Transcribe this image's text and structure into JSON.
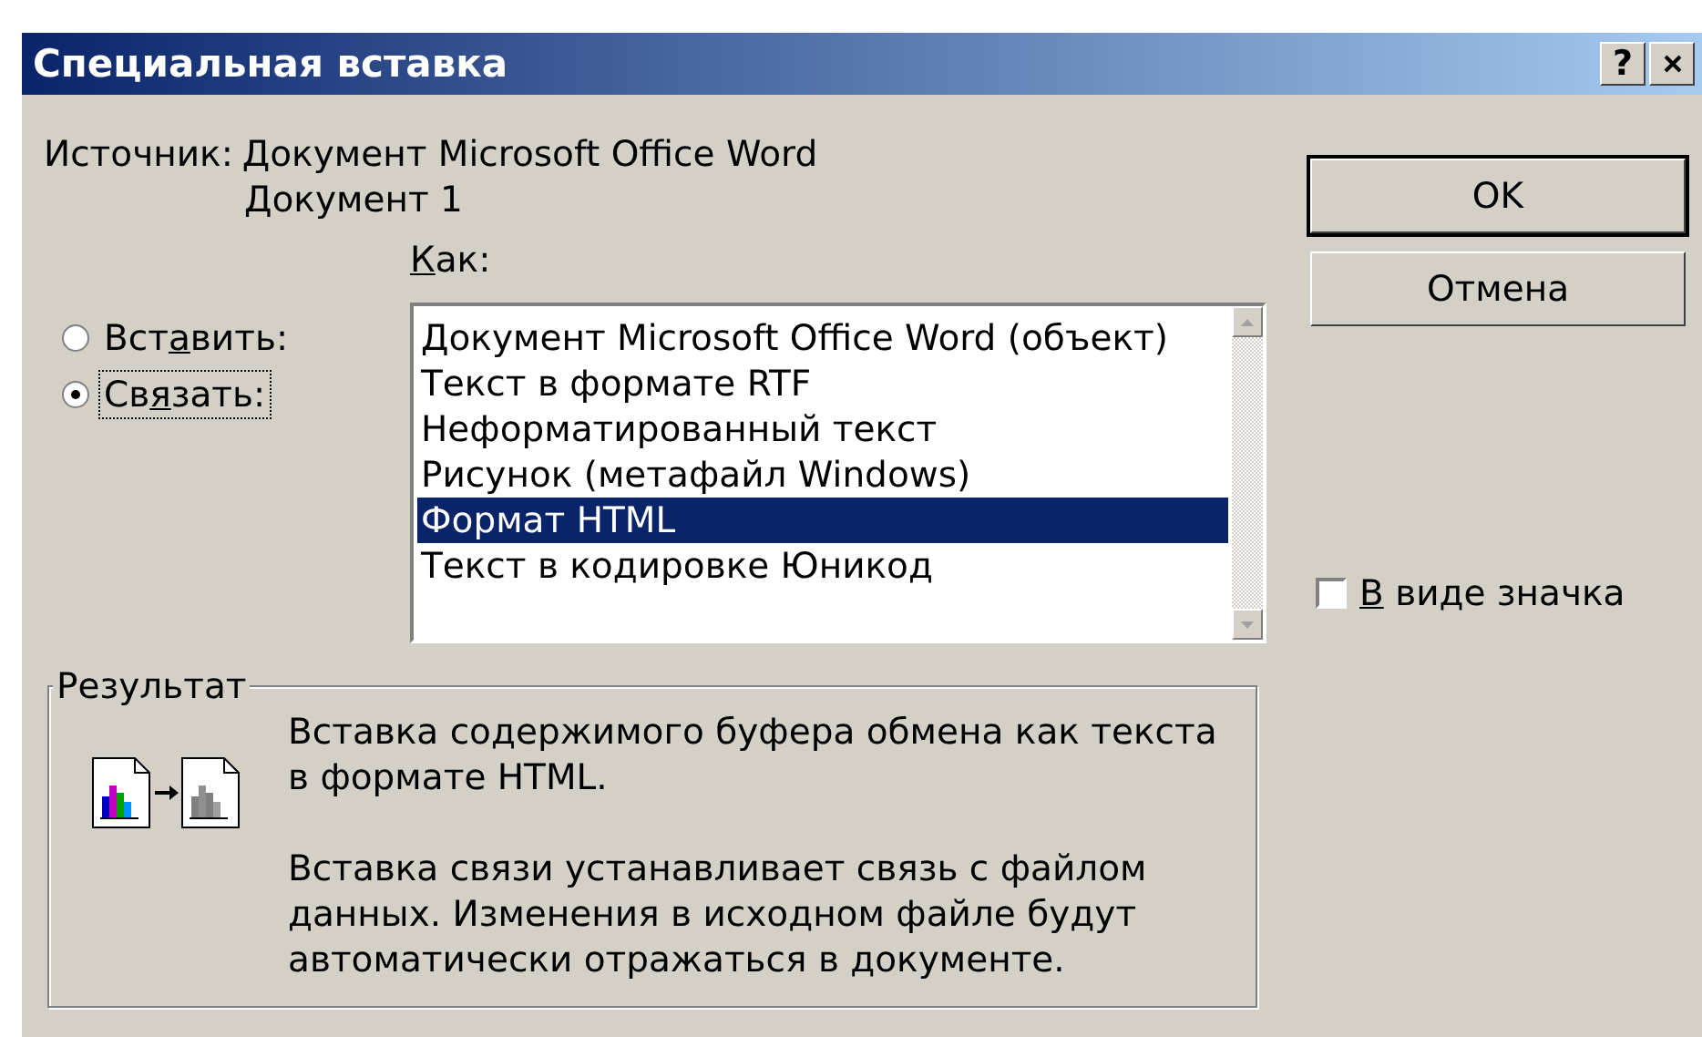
{
  "window": {
    "title": "Специальная вставка",
    "help_button": "?"
  },
  "source": {
    "label": "Источник:",
    "value": "Документ Microsoft Office Word",
    "value_2": "Документ 1"
  },
  "as_label": [
    {
      "text": "К",
      "underline": true
    },
    {
      "text": "ак:",
      "underline": false
    }
  ],
  "radios": [
    {
      "label": [
        {
          "text": "Вст",
          "underline": false
        },
        {
          "text": "а",
          "underline": true
        },
        {
          "text": "вить:",
          "underline": false
        }
      ],
      "selected": false,
      "focused": false
    },
    {
      "label": [
        {
          "text": "Св",
          "underline": false
        },
        {
          "text": "я",
          "underline": true
        },
        {
          "text": "зать:",
          "underline": false
        }
      ],
      "selected": true,
      "focused": true
    }
  ],
  "list_items": [
    {
      "label": "Документ Microsoft Office Word (объект)",
      "selected": false
    },
    {
      "label": "Текст в формате RTF",
      "selected": false
    },
    {
      "label": "Неформатированный текст",
      "selected": false
    },
    {
      "label": "Рисунок (метафайл Windows)",
      "selected": false
    },
    {
      "label": "Формат HTML",
      "selected": true
    },
    {
      "label": "Текст в кодировке Юникод",
      "selected": false
    }
  ],
  "buttons": [
    {
      "label": "OK",
      "default": true
    },
    {
      "label": "Отмена",
      "default": false
    }
  ],
  "checkbox": {
    "label": [
      {
        "text": "В",
        "underline": true
      },
      {
        "text": " виде значка",
        "underline": false
      }
    ],
    "checked": false
  },
  "result": {
    "title": "Результат",
    "paragraphs": [
      "Вставка содержимого буфера обмена как текста в формате HTML.",
      "Вставка связи устанавливает связь с файлом данных. Изменения в исходном файле будут автоматически отражаться в документе."
    ]
  }
}
